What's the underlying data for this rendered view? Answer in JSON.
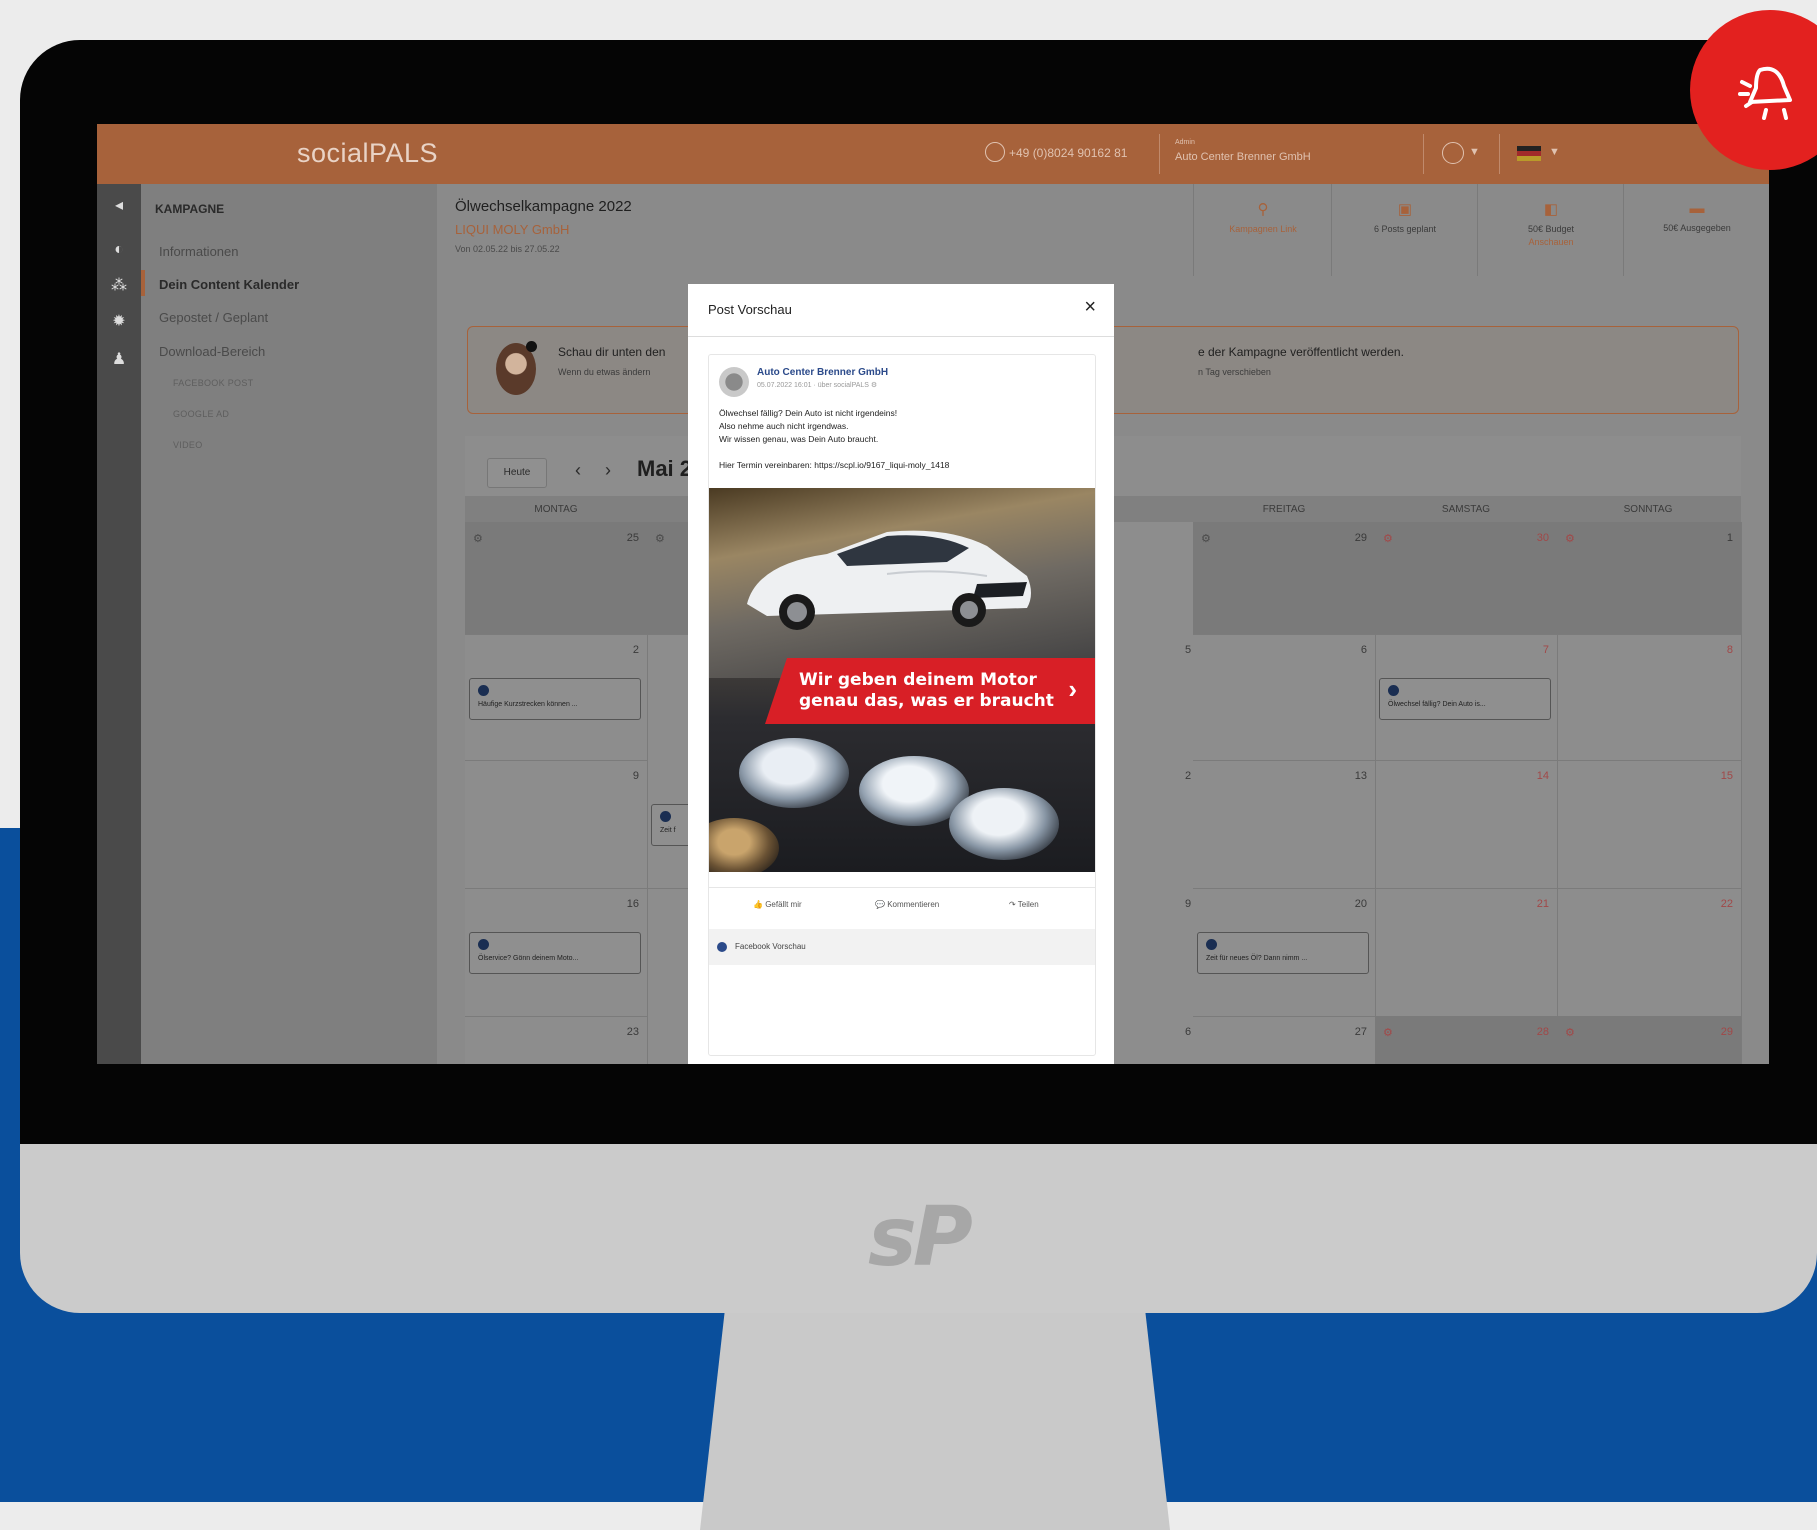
{
  "topbar": {
    "brand": "socialPALS",
    "phone": "+49 (0)8024 90162 81",
    "user_caption": "Admin",
    "user_name": "Auto Center Brenner GmbH"
  },
  "sidebar": {
    "section": "KAMPAGNE",
    "items": [
      {
        "label": "Informationen"
      },
      {
        "label": "Dein Content Kalender"
      },
      {
        "label": "Gepostet / Geplant"
      },
      {
        "label": "Download-Bereich"
      }
    ],
    "subitems": [
      {
        "label": "FACEBOOK POST"
      },
      {
        "label": "GOOGLE AD"
      },
      {
        "label": "VIDEO"
      }
    ]
  },
  "campaign": {
    "title": "Ölwechselkampagne 2022",
    "company": "LIQUI MOLY GmbH",
    "dates": "Von 02.05.22 bis 27.05.22"
  },
  "stats": [
    {
      "label": "Kampagnen Link",
      "icon": "link-icon",
      "sub": ""
    },
    {
      "label": "6 Posts geplant",
      "icon": "calendar-icon",
      "sub": ""
    },
    {
      "label": "50€ Budget",
      "icon": "budget-icon",
      "sub": "Anschauen"
    },
    {
      "label": "50€ Ausgegeben",
      "icon": "wallet-icon",
      "sub": ""
    }
  ],
  "info": {
    "line1": "Schau dir unten den",
    "line2": "Wenn du etwas ändern",
    "line3": "e der Kampagne veröffentlicht werden.",
    "line4": "n Tag verschieben"
  },
  "calendar": {
    "today_label": "Heute",
    "month": "Mai 2",
    "days": [
      "MONTAG",
      "",
      "",
      "",
      "FREITAG",
      "SAMSTAG",
      "SONNTAG"
    ],
    "visible_numbers": {
      "row1": [
        "25",
        "",
        "",
        "",
        "29",
        "30",
        "1"
      ],
      "row2": [
        "2",
        "",
        "",
        "5",
        "6",
        "7",
        "8"
      ],
      "row3": [
        "9",
        "",
        "",
        "2",
        "13",
        "14",
        "15"
      ],
      "row4": [
        "16",
        "",
        "",
        "9",
        "20",
        "21",
        "22"
      ],
      "row5": [
        "23",
        "",
        "",
        "6",
        "27",
        "28",
        "29"
      ]
    },
    "events": [
      {
        "text": "Häufige Kurzstrecken können ..."
      },
      {
        "text": "Ölwechsel fällig? Dein Auto is..."
      },
      {
        "text": "Zeit f"
      },
      {
        "text": "Ölservice? Gönn deinem Moto..."
      },
      {
        "text": "Zeit für neues Öl? Dann nimm ..."
      }
    ]
  },
  "modal": {
    "title": "Post Vorschau",
    "close": "×",
    "post": {
      "author": "Auto Center Brenner GmbH",
      "meta": "05.07.2022 16:01 · über socialPALS ⚙",
      "lines": [
        "Ölwechsel fällig? Dein Auto ist nicht irgendeins!",
        "Also nehme auch nicht irgendwas.",
        "Wir wissen genau, was Dein Auto braucht.",
        "",
        "Hier Termin vereinbaren:  https://scpl.io/9167_liqui-moly_1418"
      ],
      "banner_line1": "Wir geben deinem Motor",
      "banner_line2": "genau das, was er braucht",
      "banner_chevron": "›",
      "like": "Gefällt mir",
      "comment": "Kommentieren",
      "share": "Teilen",
      "footer": "Facebook Vorschau"
    }
  },
  "monitor_logo": "sP",
  "accent_color": "#a7623b",
  "alert_color": "#e3211f"
}
